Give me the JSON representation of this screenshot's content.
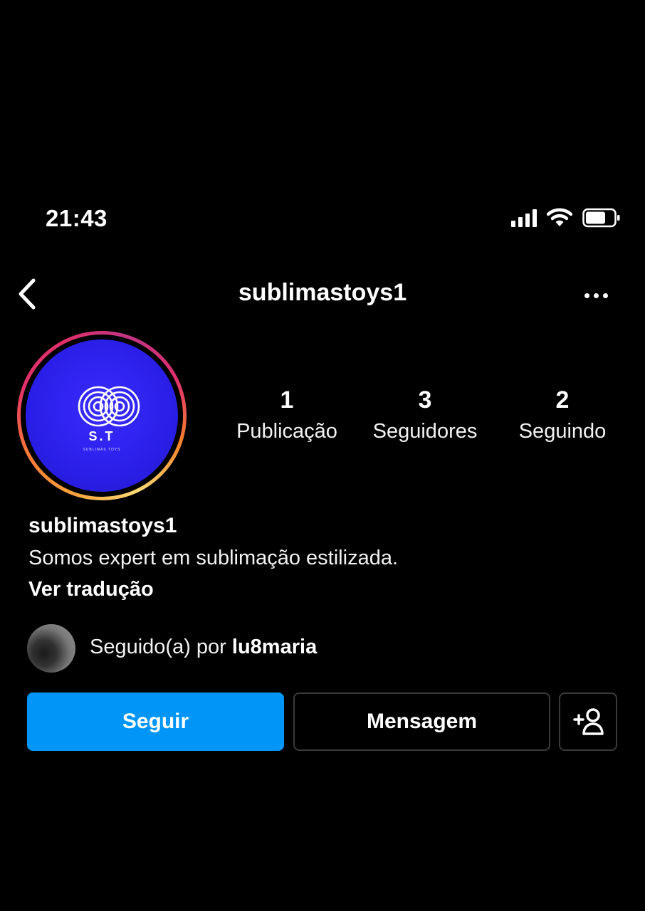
{
  "status_bar": {
    "time": "21:43",
    "icons": [
      "signal-icon",
      "wifi-icon",
      "battery-icon"
    ]
  },
  "header": {
    "username": "sublimastoys1",
    "back_icon": "chevron-left-icon",
    "more_icon": "more-horizontal-icon"
  },
  "profile": {
    "avatar_logo_text": "S.T",
    "avatar_logo_subtext": "SUBLIMAS TOYS",
    "stats": {
      "posts": {
        "value": "1",
        "label": "Publicação"
      },
      "followers": {
        "value": "3",
        "label": "Seguidores"
      },
      "following": {
        "value": "2",
        "label": "Seguindo"
      }
    },
    "name": "sublimastoys1",
    "bio": "Somos expert em sublimação estilizada.",
    "translate_label": "Ver tradução",
    "followed_by_prefix": "Seguido(a) por ",
    "followed_by_user": "lu8maria"
  },
  "actions": {
    "follow_label": "Seguir",
    "message_label": "Mensagem",
    "add_user_icon": "add-user-icon"
  },
  "colors": {
    "background": "#000000",
    "follow_button": "#0095f6",
    "avatar_bg": "#2a1fe8",
    "button_border": "#3a3a3a"
  }
}
